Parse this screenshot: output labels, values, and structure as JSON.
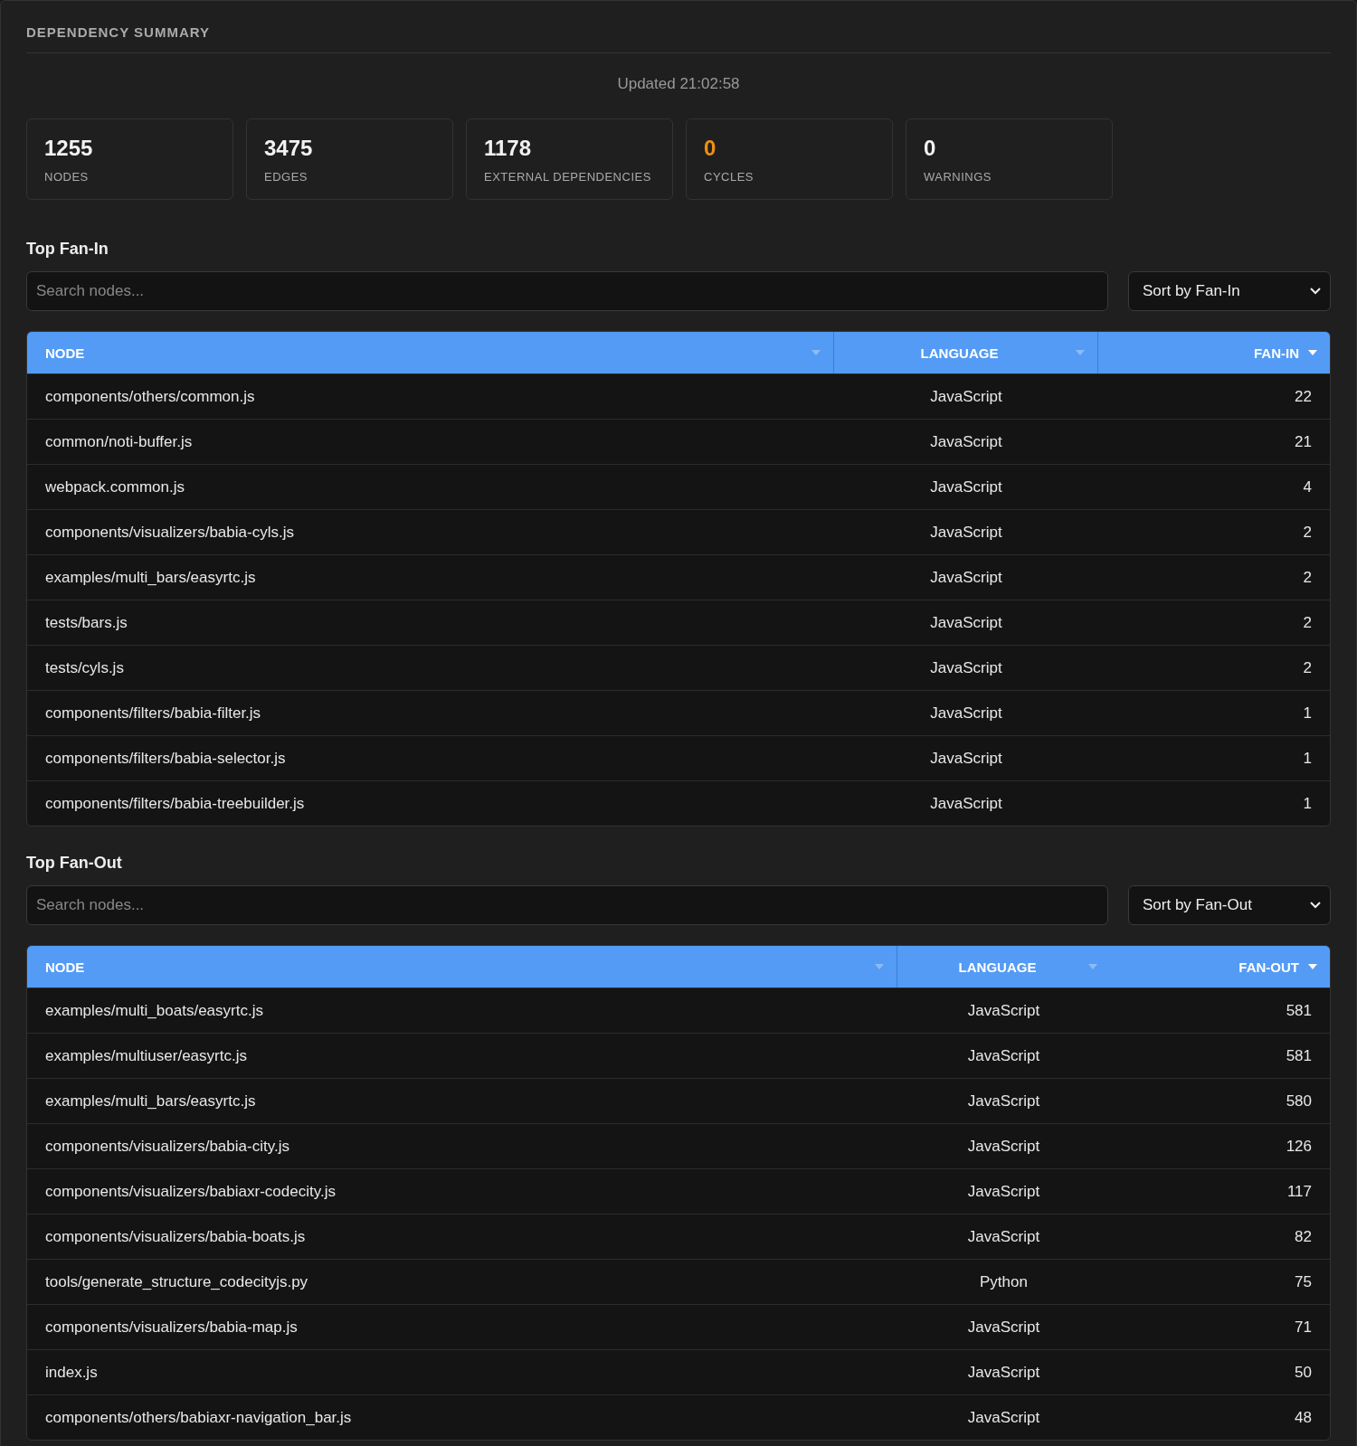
{
  "title": "DEPENDENCY SUMMARY",
  "updated": "Updated 21:02:58",
  "stats": [
    {
      "value": "1255",
      "label": "NODES",
      "kind": "normal"
    },
    {
      "value": "3475",
      "label": "EDGES",
      "kind": "normal"
    },
    {
      "value": "1178",
      "label": "EXTERNAL DEPENDENCIES",
      "kind": "normal"
    },
    {
      "value": "0",
      "label": "CYCLES",
      "kind": "alert"
    },
    {
      "value": "0",
      "label": "WARNINGS",
      "kind": "normal"
    }
  ],
  "sections": [
    {
      "title": "Top Fan-In",
      "search": {
        "placeholder": "Search nodes..."
      },
      "sort": {
        "value": "Sort by Fan-In"
      },
      "columns": [
        {
          "label": "NODE",
          "sorted": false
        },
        {
          "label": "LANGUAGE",
          "sorted": false
        },
        {
          "label": "FAN-IN",
          "sorted": true
        }
      ],
      "rows": [
        [
          "components/others/common.js",
          "JavaScript",
          "22"
        ],
        [
          "common/noti-buffer.js",
          "JavaScript",
          "21"
        ],
        [
          "webpack.common.js",
          "JavaScript",
          "4"
        ],
        [
          "components/visualizers/babia-cyls.js",
          "JavaScript",
          "2"
        ],
        [
          "examples/multi_bars/easyrtc.js",
          "JavaScript",
          "2"
        ],
        [
          "tests/bars.js",
          "JavaScript",
          "2"
        ],
        [
          "tests/cyls.js",
          "JavaScript",
          "2"
        ],
        [
          "components/filters/babia-filter.js",
          "JavaScript",
          "1"
        ],
        [
          "components/filters/babia-selector.js",
          "JavaScript",
          "1"
        ],
        [
          "components/filters/babia-treebuilder.js",
          "JavaScript",
          "1"
        ]
      ]
    },
    {
      "title": "Top Fan-Out",
      "search": {
        "placeholder": "Search nodes..."
      },
      "sort": {
        "value": "Sort by Fan-Out"
      },
      "columns": [
        {
          "label": "NODE",
          "sorted": false
        },
        {
          "label": "LANGUAGE",
          "sorted": false
        },
        {
          "label": "FAN-OUT",
          "sorted": true
        }
      ],
      "rows": [
        [
          "examples/multi_boats/easyrtc.js",
          "JavaScript",
          "581"
        ],
        [
          "examples/multiuser/easyrtc.js",
          "JavaScript",
          "581"
        ],
        [
          "examples/multi_bars/easyrtc.js",
          "JavaScript",
          "580"
        ],
        [
          "components/visualizers/babia-city.js",
          "JavaScript",
          "126"
        ],
        [
          "components/visualizers/babiaxr-codecity.js",
          "JavaScript",
          "117"
        ],
        [
          "components/visualizers/babia-boats.js",
          "JavaScript",
          "82"
        ],
        [
          "tools/generate_structure_codecityjs.py",
          "Python",
          "75"
        ],
        [
          "components/visualizers/babia-map.js",
          "JavaScript",
          "71"
        ],
        [
          "index.js",
          "JavaScript",
          "50"
        ],
        [
          "components/others/babiaxr-navigation_bar.js",
          "JavaScript",
          "48"
        ]
      ]
    }
  ]
}
